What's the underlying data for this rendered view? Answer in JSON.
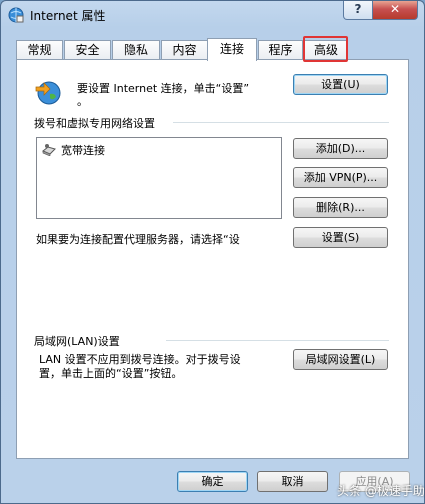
{
  "window": {
    "title": "Internet 属性",
    "help_label": "?",
    "close_label": "✕"
  },
  "tabs": [
    {
      "label": "常规"
    },
    {
      "label": "安全"
    },
    {
      "label": "隐私"
    },
    {
      "label": "内容"
    },
    {
      "label": "连接",
      "active": true
    },
    {
      "label": "程序"
    },
    {
      "label": "高级",
      "highlighted": true
    }
  ],
  "setup": {
    "text_line1": "要设置 Internet 连接，单击“设置”",
    "text_line2": "。",
    "button": "设置(U)"
  },
  "dialup": {
    "heading": "拨号和虚拟专用网络设置",
    "list_items": [
      "宽带连接"
    ],
    "add_button": "添加(D)...",
    "add_vpn_button": "添加 VPN(P)...",
    "remove_button": "删除(R)...",
    "settings_button": "设置(S)",
    "proxy_text": "如果要为连接配置代理服务器，请选择“设"
  },
  "lan": {
    "heading": "局域网(LAN)设置",
    "text_line1": "LAN 设置不应用到拨号连接。对于拨号设",
    "text_line2": "置，单击上面的“设置”按钮。",
    "button": "局域网设置(L)"
  },
  "footer": {
    "ok": "确定",
    "cancel": "取消",
    "apply": "应用(A)"
  },
  "watermark": "头条 @极速手助",
  "colors": {
    "highlight": "#e03535",
    "close_button": "#c75050"
  }
}
